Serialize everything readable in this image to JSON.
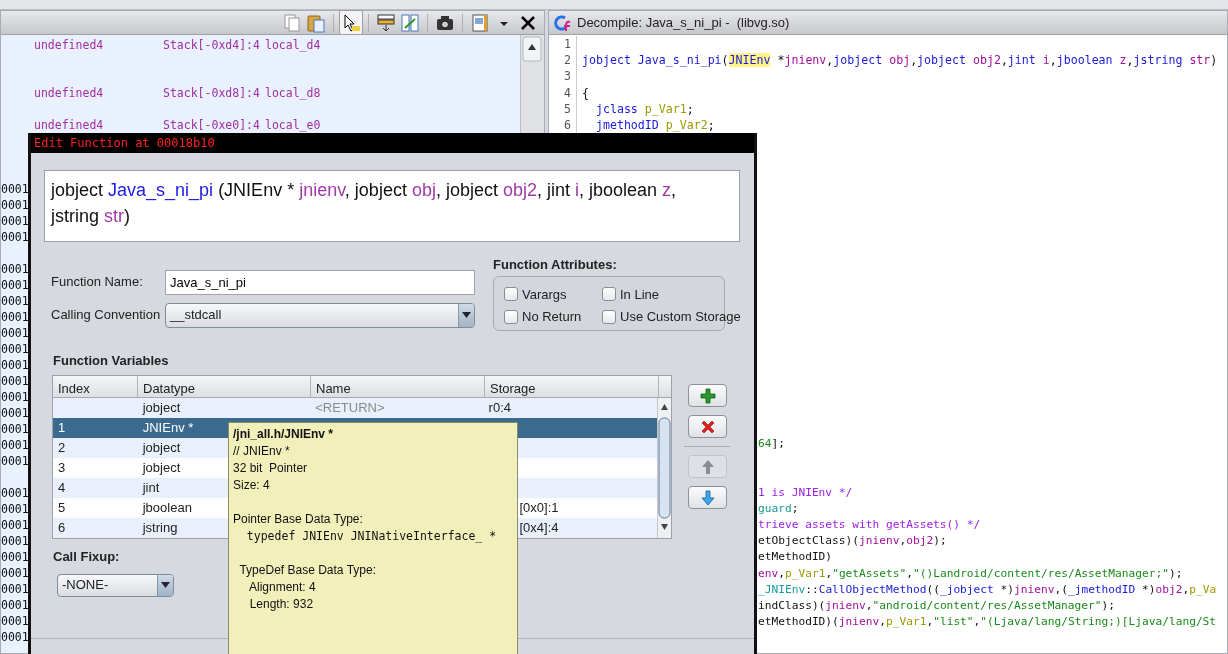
{
  "listing": {
    "rows": [
      {
        "kind": "var",
        "datatype": "undefined4",
        "storage": "Stack[-0xd4]:4",
        "name": "local_d4"
      },
      {
        "kind": "blank"
      },
      {
        "kind": "blank"
      },
      {
        "kind": "var",
        "datatype": "undefined4",
        "storage": "Stack[-0xd8]:4",
        "name": "local_d8"
      },
      {
        "kind": "blank"
      },
      {
        "kind": "var",
        "datatype": "undefined4",
        "storage": "Stack[-0xe0]:4",
        "name": "local_e0"
      },
      {
        "kind": "blank"
      },
      {
        "kind": "blank"
      },
      {
        "kind": "blank"
      },
      {
        "kind": "address",
        "text": "0001"
      },
      {
        "kind": "address",
        "text": "0001"
      },
      {
        "kind": "address",
        "text": "0001"
      },
      {
        "kind": "address",
        "text": "0001"
      },
      {
        "kind": "blank"
      },
      {
        "kind": "address",
        "text": "0001"
      },
      {
        "kind": "address",
        "text": "0001"
      },
      {
        "kind": "address",
        "text": "0001"
      },
      {
        "kind": "address",
        "text": "0001"
      },
      {
        "kind": "address",
        "text": "0001"
      },
      {
        "kind": "address",
        "text": "0001"
      },
      {
        "kind": "address",
        "text": "0001"
      },
      {
        "kind": "address",
        "text": "0001"
      },
      {
        "kind": "address",
        "text": "0001"
      },
      {
        "kind": "address",
        "text": "0001"
      },
      {
        "kind": "address",
        "text": "0001"
      },
      {
        "kind": "address",
        "text": "0001"
      },
      {
        "kind": "address",
        "text": "0001"
      },
      {
        "kind": "blank"
      },
      {
        "kind": "address",
        "text": "0001"
      },
      {
        "kind": "address",
        "text": "0001"
      },
      {
        "kind": "address",
        "text": "0001"
      },
      {
        "kind": "address",
        "text": "0001"
      },
      {
        "kind": "address",
        "text": "0001"
      },
      {
        "kind": "address",
        "text": "0001"
      },
      {
        "kind": "address",
        "text": "0001"
      },
      {
        "kind": "address",
        "text": "0001"
      },
      {
        "kind": "address",
        "text": "0001"
      },
      {
        "kind": "address",
        "text": "0001"
      }
    ]
  },
  "decompiler": {
    "title": "Decompile: Java_s_ni_pi -  (libvg.so)",
    "lines": [
      {
        "number": "1"
      },
      {
        "number": "2",
        "tokens": [
          {
            "kind": "type",
            "text": "jobject "
          },
          {
            "kind": "func",
            "text": "Java_s_ni_pi"
          },
          {
            "kind": "plain",
            "text": "("
          },
          {
            "kind": "type",
            "text": "JNIEnv",
            "highlighted": true
          },
          {
            "kind": "plain",
            "text": " *"
          },
          {
            "kind": "param",
            "text": "jnienv"
          },
          {
            "kind": "plain",
            "text": ","
          },
          {
            "kind": "type",
            "text": "jobject "
          },
          {
            "kind": "param",
            "text": "obj"
          },
          {
            "kind": "plain",
            "text": ","
          },
          {
            "kind": "type",
            "text": "jobject "
          },
          {
            "kind": "param",
            "text": "obj2"
          },
          {
            "kind": "plain",
            "text": ","
          },
          {
            "kind": "type",
            "text": "jint "
          },
          {
            "kind": "param",
            "text": "i"
          },
          {
            "kind": "plain",
            "text": ","
          },
          {
            "kind": "type",
            "text": "jboolean "
          },
          {
            "kind": "param",
            "text": "z"
          },
          {
            "kind": "plain",
            "text": ","
          },
          {
            "kind": "type",
            "text": "jstring "
          },
          {
            "kind": "param",
            "text": "str"
          },
          {
            "kind": "plain",
            "text": ")"
          }
        ]
      },
      {
        "number": "3"
      },
      {
        "number": "4",
        "tokens": [
          {
            "kind": "plain",
            "text": "{"
          }
        ]
      },
      {
        "number": "5",
        "tokens": [
          {
            "kind": "type",
            "text": "  jclass "
          },
          {
            "kind": "local",
            "text": "p_Var1"
          },
          {
            "kind": "plain",
            "text": ";"
          }
        ]
      },
      {
        "number": "6",
        "tokens": [
          {
            "kind": "type",
            "text": "  jmethodID "
          },
          {
            "kind": "local",
            "text": "p_Var2"
          },
          {
            "kind": "plain",
            "text": ";"
          }
        ]
      }
    ],
    "lines_right_of_dialog": [
      {
        "kind": "code",
        "tokens": [
          {
            "kind": "number",
            "text": "64"
          },
          {
            "kind": "plain",
            "text": "];"
          }
        ]
      },
      {
        "kind": "blank"
      },
      {
        "kind": "blank"
      },
      {
        "kind": "code",
        "tokens": [
          {
            "kind": "comment",
            "text": "1 is JNIEnv */"
          }
        ]
      },
      {
        "kind": "code",
        "tokens": [
          {
            "kind": "global",
            "text": "guard"
          },
          {
            "kind": "plain",
            "text": ";"
          }
        ]
      },
      {
        "kind": "code",
        "tokens": [
          {
            "kind": "comment",
            "text": "trieve assets with getAssets() */"
          }
        ]
      },
      {
        "kind": "code",
        "tokens": [
          {
            "kind": "plain",
            "text": "etObjectClass)("
          },
          {
            "kind": "param",
            "text": "jnienv"
          },
          {
            "kind": "plain",
            "text": ","
          },
          {
            "kind": "param",
            "text": "obj2"
          },
          {
            "kind": "plain",
            "text": ");"
          }
        ]
      },
      {
        "kind": "code",
        "tokens": [
          {
            "kind": "plain",
            "text": "etMethodID)"
          }
        ]
      },
      {
        "kind": "code",
        "tokens": [
          {
            "kind": "param",
            "text": "env"
          },
          {
            "kind": "plain",
            "text": ","
          },
          {
            "kind": "local",
            "text": "p_Var1"
          },
          {
            "kind": "plain",
            "text": ","
          },
          {
            "kind": "string",
            "text": "\"getAssets\""
          },
          {
            "kind": "plain",
            "text": ","
          },
          {
            "kind": "string",
            "text": "\"()Landroid/content/res/AssetManager;\""
          },
          {
            "kind": "plain",
            "text": ");"
          }
        ]
      },
      {
        "kind": "code",
        "tokens": [
          {
            "kind": "global",
            "text": "_JNIEnv"
          },
          {
            "kind": "plain",
            "text": "::"
          },
          {
            "kind": "func",
            "text": "CallObjectMethod"
          },
          {
            "kind": "plain",
            "text": "(("
          },
          {
            "kind": "type",
            "text": "_jobject"
          },
          {
            "kind": "plain",
            "text": " *)"
          },
          {
            "kind": "param",
            "text": "jnienv"
          },
          {
            "kind": "plain",
            "text": ",("
          },
          {
            "kind": "type",
            "text": "_jmethodID"
          },
          {
            "kind": "plain",
            "text": " *)"
          },
          {
            "kind": "param",
            "text": "obj2"
          },
          {
            "kind": "plain",
            "text": ","
          },
          {
            "kind": "local",
            "text": "p_Va"
          }
        ]
      },
      {
        "kind": "code",
        "tokens": [
          {
            "kind": "plain",
            "text": "indClass)("
          },
          {
            "kind": "param",
            "text": "jnienv"
          },
          {
            "kind": "plain",
            "text": ","
          },
          {
            "kind": "string",
            "text": "\"android/content/res/AssetManager\""
          },
          {
            "kind": "plain",
            "text": ");"
          }
        ]
      },
      {
        "kind": "code",
        "tokens": [
          {
            "kind": "plain",
            "text": "etMethodID)("
          },
          {
            "kind": "param",
            "text": "jnienv"
          },
          {
            "kind": "plain",
            "text": ","
          },
          {
            "kind": "local",
            "text": "p_Var1"
          },
          {
            "kind": "plain",
            "text": ","
          },
          {
            "kind": "string",
            "text": "\"list\""
          },
          {
            "kind": "plain",
            "text": ","
          },
          {
            "kind": "string",
            "text": "\"(Ljava/lang/String;)[Ljava/lang/St"
          }
        ]
      }
    ]
  },
  "dialog": {
    "title": "Edit Function at 00018b10",
    "signature": [
      {
        "kind": "plain",
        "text": "jobject "
      },
      {
        "kind": "name",
        "text": "Java_s_ni_pi"
      },
      {
        "kind": "plain",
        "text": " (JNIEnv * "
      },
      {
        "kind": "param",
        "text": "jnienv"
      },
      {
        "kind": "plain",
        "text": ", jobject "
      },
      {
        "kind": "param",
        "text": "obj"
      },
      {
        "kind": "plain",
        "text": ", jobject "
      },
      {
        "kind": "param",
        "text": "obj2"
      },
      {
        "kind": "plain",
        "text": ", jint "
      },
      {
        "kind": "param",
        "text": "i"
      },
      {
        "kind": "plain",
        "text": ", jboolean "
      },
      {
        "kind": "param",
        "text": "z"
      },
      {
        "kind": "plain",
        "text": ", "
      },
      {
        "kind": "break"
      },
      {
        "kind": "plain",
        "text": "jstring "
      },
      {
        "kind": "param",
        "text": "str"
      },
      {
        "kind": "plain",
        "text": ")"
      }
    ],
    "function_name": {
      "label": "Function Name:",
      "value": "Java_s_ni_pi"
    },
    "calling_convention": {
      "label": "Calling Convention",
      "value": "__stdcall"
    },
    "attributes": {
      "label": "Function Attributes:",
      "options": [
        {
          "label": "Varargs",
          "checked": false
        },
        {
          "label": "In Line",
          "checked": false
        },
        {
          "label": "No Return",
          "checked": false
        },
        {
          "label": "Use Custom Storage",
          "checked": false
        }
      ]
    },
    "variables": {
      "label": "Function Variables",
      "columns": [
        "Index",
        "Datatype",
        "Name",
        "Storage"
      ],
      "rows": [
        {
          "datatype": "jobject",
          "name": "<RETURN>",
          "storage": "r0:4",
          "selected": false
        },
        {
          "index": "1",
          "datatype": "JNIEnv *",
          "selected": true
        },
        {
          "index": "2",
          "datatype": "jobject",
          "selected": false
        },
        {
          "index": "3",
          "datatype": "jobject",
          "selected": false
        },
        {
          "index": "4",
          "datatype": "jint",
          "selected": false
        },
        {
          "index": "5",
          "datatype": "jboolean",
          "storage": "[0x0]:1",
          "storage_clipped": true,
          "selected": false
        },
        {
          "index": "6",
          "datatype": "jstring",
          "storage": "[0x4]:4",
          "storage_clipped": true,
          "selected": false
        }
      ]
    },
    "row_buttons": [
      {
        "kind": "add",
        "disabled": false
      },
      {
        "kind": "remove",
        "disabled": false
      },
      {
        "kind": "up",
        "disabled": true
      },
      {
        "kind": "down",
        "disabled": false
      }
    ],
    "call_fixup": {
      "label": "Call Fixup:",
      "value": "-NONE-"
    }
  },
  "tooltip": {
    "lines": [
      {
        "kind": "heading",
        "text": "/jni_all.h/JNIEnv *"
      },
      {
        "kind": "text",
        "text": "// JNIEnv *"
      },
      {
        "kind": "text",
        "text": "32 bit  Pointer"
      },
      {
        "kind": "text",
        "text": "Size: 4"
      },
      {
        "kind": "blank"
      },
      {
        "kind": "text",
        "text": "Pointer Base Data Type:"
      },
      {
        "kind": "code",
        "text": "  typedef JNIEnv JNINativeInterface_ *"
      },
      {
        "kind": "blank"
      },
      {
        "kind": "text",
        "text": "  TypeDef Base Data Type:"
      },
      {
        "kind": "text",
        "text": "     Alignment: 4"
      },
      {
        "kind": "text",
        "text": "     Length: 932"
      }
    ]
  }
}
